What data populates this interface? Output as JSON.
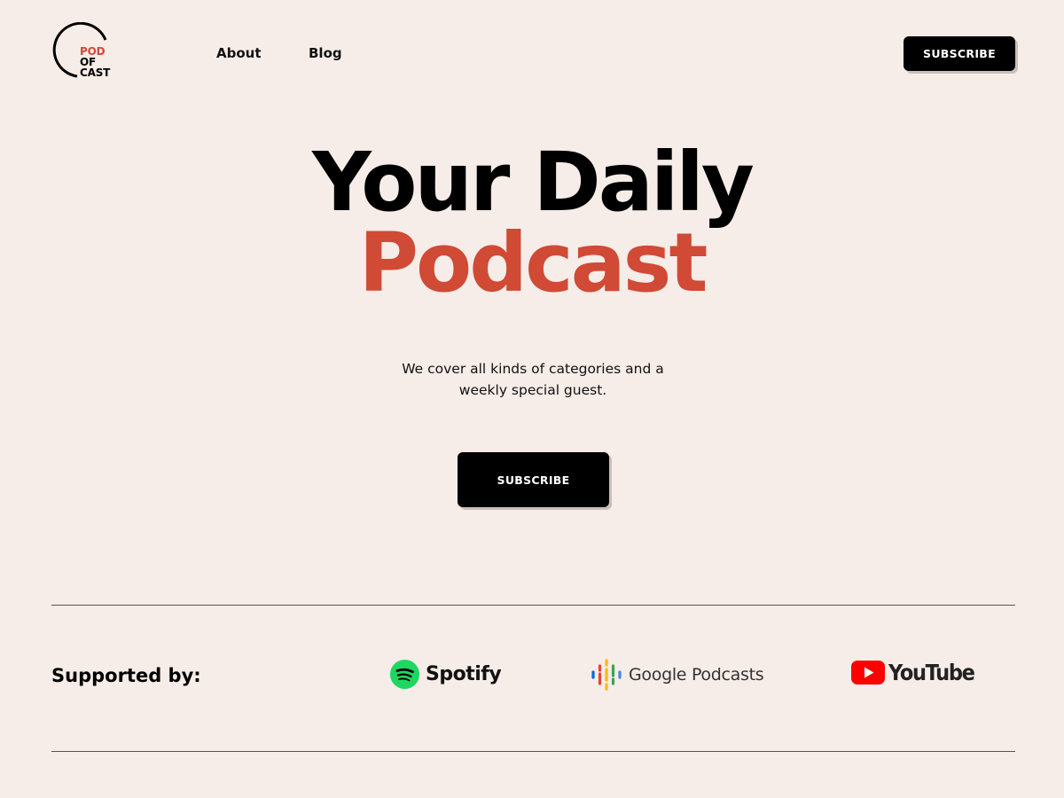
{
  "logo": {
    "line1": "POD",
    "line2": "OF",
    "line3": "CAST"
  },
  "nav": {
    "about": "About",
    "blog": "Blog"
  },
  "header_cta": "SUBSCRIBE",
  "hero": {
    "title_line1": "Your Daily",
    "title_line2": "Podcast",
    "subtitle": "We cover all kinds of categories and a weekly special guest.",
    "cta": "SUBSCRIBE"
  },
  "supported": {
    "label": "Supported by:",
    "brands": [
      {
        "name": "Spotify",
        "icon": "spotify-icon",
        "color": "#1ed760"
      },
      {
        "name": "Google Podcasts",
        "icon": "google-podcasts-icon",
        "color": "#4285f4"
      },
      {
        "name": "YouTube",
        "icon": "youtube-icon",
        "color": "#ff0000"
      }
    ]
  },
  "colors": {
    "background": "#f6ece8",
    "accent": "#d04a35",
    "button": "#000000"
  }
}
